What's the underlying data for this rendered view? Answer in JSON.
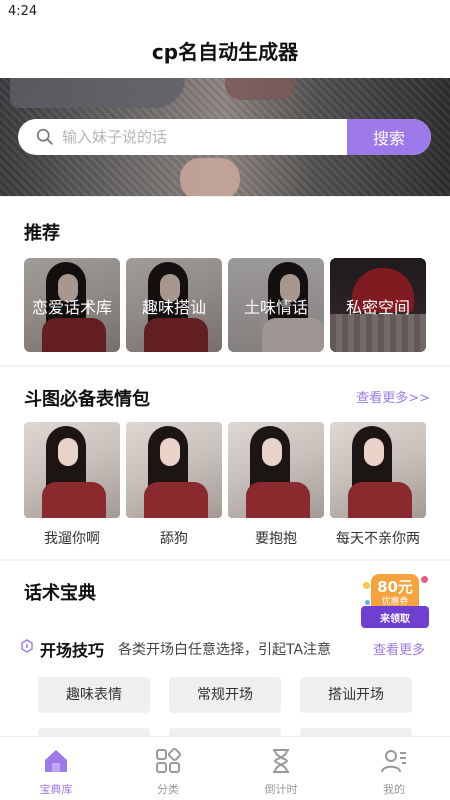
{
  "status_bar": {
    "time": "4:24"
  },
  "header": {
    "title": "cp名自动生成器"
  },
  "search": {
    "placeholder": "输入妹子说的话",
    "button_label": "搜索"
  },
  "recommend": {
    "title": "推荐",
    "cards": [
      {
        "label": "恋爱话术库"
      },
      {
        "label": "趣味搭讪"
      },
      {
        "label": "土味情话"
      },
      {
        "label": "私密空间"
      }
    ]
  },
  "memes": {
    "title": "斗图必备表情包",
    "more_label": "查看更多>>",
    "items": [
      {
        "label": "我遛你啊"
      },
      {
        "label": "舔狗"
      },
      {
        "label": "要抱抱"
      },
      {
        "label": "每天不亲你两"
      }
    ]
  },
  "talk": {
    "title": "话术宝典",
    "sub_title": "开场技巧",
    "sub_desc": "各类开场白任意选择，引起TA注意",
    "more_label": "查看更多",
    "chips": [
      "趣味表情",
      "常规开场",
      "搭讪开场"
    ]
  },
  "coupon": {
    "amount": "80元",
    "subtitle": "优惠券",
    "action": "来领取"
  },
  "tabbar": {
    "items": [
      {
        "label": "宝典库",
        "icon": "home-icon",
        "active": true
      },
      {
        "label": "分类",
        "icon": "category-icon",
        "active": false
      },
      {
        "label": "倒计时",
        "icon": "hourglass-icon",
        "active": false
      },
      {
        "label": "我的",
        "icon": "profile-icon",
        "active": false
      }
    ]
  },
  "colors": {
    "accent": "#9d79ea",
    "coupon_orange": "#f7a23c",
    "coupon_purple": "#6e3fd0"
  }
}
